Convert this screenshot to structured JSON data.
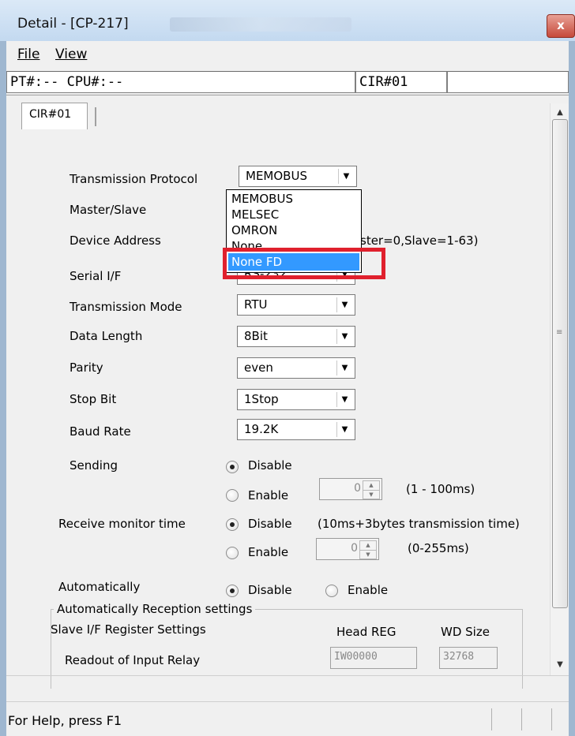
{
  "window": {
    "title": "Detail - [CP-217]",
    "close_label": "x"
  },
  "menu": {
    "file": "File",
    "view": "View"
  },
  "infobar": {
    "pt_cpu": "PT#:-- CPU#:--",
    "cir": "CIR#01",
    "empty": ""
  },
  "tab": {
    "label": "CIR#01"
  },
  "form": {
    "transmission_protocol": {
      "label": "Transmission Protocol",
      "value": "MEMOBUS"
    },
    "master_slave": {
      "label": "Master/Slave"
    },
    "device_address": {
      "label": "Device Address",
      "hint": "ster=0,Slave=1-63)"
    },
    "serial_if": {
      "label": "Serial I/F",
      "value": "RS-232"
    },
    "transmission_mode": {
      "label": "Transmission Mode",
      "value": "RTU"
    },
    "data_length": {
      "label": "Data Length",
      "value": "8Bit"
    },
    "parity": {
      "label": "Parity",
      "value": "even"
    },
    "stop_bit": {
      "label": "Stop Bit",
      "value": "1Stop"
    },
    "baud_rate": {
      "label": "Baud Rate",
      "value": "19.2K"
    }
  },
  "dropdown": {
    "options": [
      "MEMOBUS",
      "MELSEC",
      "OMRON",
      "None",
      "None FD"
    ],
    "selected": "None FD"
  },
  "sending": {
    "label": "Sending",
    "disable": "Disable",
    "enable": "Enable",
    "spin_value": "0",
    "range": "(1 - 100ms)",
    "selected": "Disable"
  },
  "receive": {
    "label": "Receive monitor time",
    "disable": "Disable",
    "enable": "Enable",
    "note": "(10ms+3bytes transmission time)",
    "spin_value": "0",
    "range": "(0-255ms)",
    "selected": "Disable"
  },
  "automatically": {
    "label": "Automatically",
    "disable": "Disable",
    "enable": "Enable",
    "selected": "Disable"
  },
  "reception": {
    "group_title": "Automatically Reception settings",
    "slave_register": "Slave I/F Register Settings",
    "head_reg_header": "Head REG",
    "wd_size_header": "WD Size",
    "readout_label": "Readout of Input Relay",
    "readout_head": "IW00000",
    "readout_size": "32768"
  },
  "status": {
    "help_text": "For Help, press F1"
  },
  "colors": {
    "highlight": "#e0202d",
    "selection": "#3399ff"
  }
}
